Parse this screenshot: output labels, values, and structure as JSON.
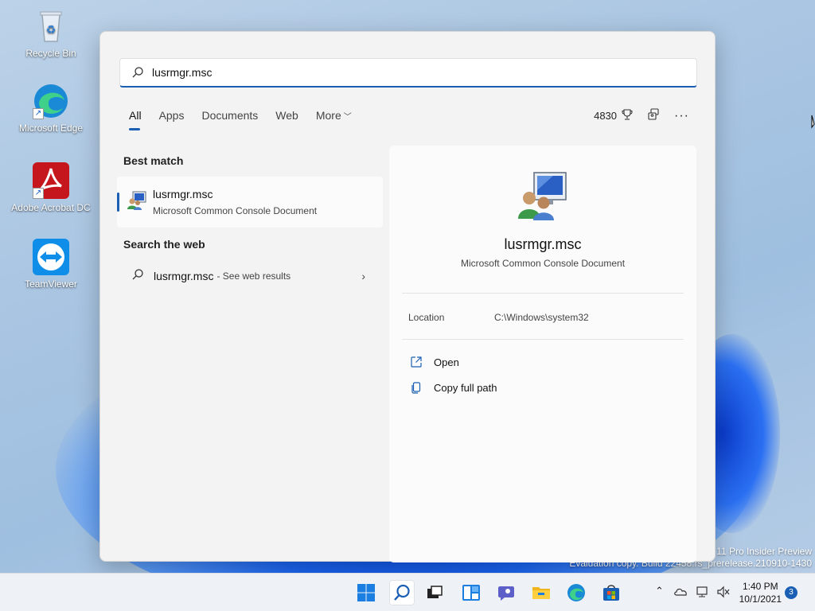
{
  "desktop": {
    "icons": [
      {
        "label": "Recycle Bin"
      },
      {
        "label": "Microsoft Edge"
      },
      {
        "label": "Adobe Acrobat DC"
      },
      {
        "label": "TeamViewer"
      }
    ],
    "watermark_line1": "11 Pro Insider Preview",
    "watermark_line2": "Evaluation copy. Build 22458.rs_prerelease.210910-1430"
  },
  "search": {
    "query": "lusrmgr.msc",
    "tabs": [
      {
        "label": "All"
      },
      {
        "label": "Apps"
      },
      {
        "label": "Documents"
      },
      {
        "label": "Web"
      },
      {
        "label": "More"
      }
    ],
    "points": "4830"
  },
  "results": {
    "best_match_title": "Best match",
    "best_match": {
      "name": "lusrmgr.msc",
      "type": "Microsoft Common Console Document"
    },
    "web_title": "Search the web",
    "web_result": {
      "name": "lusrmgr.msc",
      "suffix": "- See web results"
    }
  },
  "detail": {
    "name": "lusrmgr.msc",
    "type": "Microsoft Common Console Document",
    "location_label": "Location",
    "location_value": "C:\\Windows\\system32",
    "actions": [
      {
        "label": "Open"
      },
      {
        "label": "Copy full path"
      }
    ]
  },
  "taskbar": {
    "time": "1:40 PM",
    "date": "10/1/2021",
    "notification_count": "3"
  },
  "colors": {
    "accent": "#1a5fb4"
  }
}
